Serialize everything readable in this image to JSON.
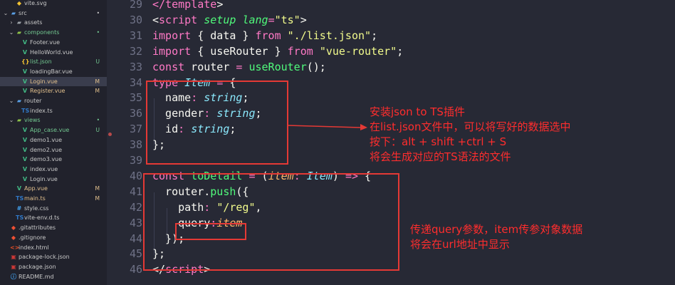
{
  "sidebar": {
    "items": [
      {
        "label": "vite.svg",
        "chev": "",
        "icon": "◆",
        "icon_color": "#f1c232",
        "label_color": "#c8c8c8",
        "badge": "",
        "indent": 22,
        "selected": false
      },
      {
        "label": "src",
        "chev": "⌄",
        "icon": "▰",
        "icon_color": "#5aa0e6",
        "label_color": "#c8c8c8",
        "badge": "•",
        "indent": 14,
        "selected": false
      },
      {
        "label": "assets",
        "chev": "›",
        "icon": "▰",
        "icon_color": "#9aa0a6",
        "label_color": "#c8c8c8",
        "badge": "",
        "indent": 22,
        "selected": false
      },
      {
        "label": "components",
        "chev": "⌄",
        "icon": "▰",
        "icon_color": "#8dc149",
        "label_color": "#73c991",
        "badge": "•",
        "indent": 22,
        "selected": false
      },
      {
        "label": "Footer.vue",
        "chev": "",
        "icon": "V",
        "icon_color": "#41b883",
        "label_color": "#c8c8c8",
        "badge": "",
        "indent": 30,
        "selected": false
      },
      {
        "label": "HelloWorld.vue",
        "chev": "",
        "icon": "V",
        "icon_color": "#41b883",
        "label_color": "#c8c8c8",
        "badge": "",
        "indent": 30,
        "selected": false
      },
      {
        "label": "list.json",
        "chev": "",
        "icon": "{}",
        "icon_color": "#f1c232",
        "label_color": "#73c991",
        "badge": "U",
        "indent": 30,
        "selected": false
      },
      {
        "label": "loadingBar.vue",
        "chev": "",
        "icon": "V",
        "icon_color": "#41b883",
        "label_color": "#c8c8c8",
        "badge": "",
        "indent": 30,
        "selected": false
      },
      {
        "label": "Login.vue",
        "chev": "",
        "icon": "V",
        "icon_color": "#41b883",
        "label_color": "#e2c08d",
        "badge": "M",
        "indent": 30,
        "selected": true
      },
      {
        "label": "Register.vue",
        "chev": "",
        "icon": "V",
        "icon_color": "#41b883",
        "label_color": "#e2c08d",
        "badge": "M",
        "indent": 30,
        "selected": false
      },
      {
        "label": "router",
        "chev": "⌄",
        "icon": "▰",
        "icon_color": "#5aa0e6",
        "label_color": "#c8c8c8",
        "badge": "",
        "indent": 22,
        "selected": false
      },
      {
        "label": "index.ts",
        "chev": "",
        "icon": "TS",
        "icon_color": "#3178c6",
        "label_color": "#c8c8c8",
        "badge": "",
        "indent": 30,
        "selected": false
      },
      {
        "label": "views",
        "chev": "⌄",
        "icon": "▰",
        "icon_color": "#8dc149",
        "label_color": "#73c991",
        "badge": "•",
        "indent": 22,
        "selected": false
      },
      {
        "label": "App_case.vue",
        "chev": "",
        "icon": "V",
        "icon_color": "#41b883",
        "label_color": "#73c991",
        "badge": "U",
        "indent": 30,
        "selected": false
      },
      {
        "label": "demo1.vue",
        "chev": "",
        "icon": "V",
        "icon_color": "#41b883",
        "label_color": "#c8c8c8",
        "badge": "",
        "indent": 30,
        "selected": false
      },
      {
        "label": "demo2.vue",
        "chev": "",
        "icon": "V",
        "icon_color": "#41b883",
        "label_color": "#c8c8c8",
        "badge": "",
        "indent": 30,
        "selected": false
      },
      {
        "label": "demo3.vue",
        "chev": "",
        "icon": "V",
        "icon_color": "#41b883",
        "label_color": "#c8c8c8",
        "badge": "",
        "indent": 30,
        "selected": false
      },
      {
        "label": "index.vue",
        "chev": "",
        "icon": "V",
        "icon_color": "#41b883",
        "label_color": "#c8c8c8",
        "badge": "",
        "indent": 30,
        "selected": false
      },
      {
        "label": "Login.vue",
        "chev": "",
        "icon": "V",
        "icon_color": "#41b883",
        "label_color": "#c8c8c8",
        "badge": "",
        "indent": 30,
        "selected": false
      },
      {
        "label": "App.vue",
        "chev": "",
        "icon": "V",
        "icon_color": "#41b883",
        "label_color": "#e2c08d",
        "badge": "M",
        "indent": 22,
        "selected": false
      },
      {
        "label": "main.ts",
        "chev": "",
        "icon": "TS",
        "icon_color": "#3178c6",
        "label_color": "#e2c08d",
        "badge": "M",
        "indent": 22,
        "selected": false
      },
      {
        "label": "style.css",
        "chev": "",
        "icon": "#",
        "icon_color": "#42a5f5",
        "label_color": "#c8c8c8",
        "badge": "",
        "indent": 22,
        "selected": false
      },
      {
        "label": "vite-env.d.ts",
        "chev": "",
        "icon": "TS",
        "icon_color": "#3178c6",
        "label_color": "#c8c8c8",
        "badge": "",
        "indent": 22,
        "selected": false
      },
      {
        "label": ".gitattributes",
        "chev": "",
        "icon": "◆",
        "icon_color": "#f05033",
        "label_color": "#c8c8c8",
        "badge": "",
        "indent": 14,
        "selected": false
      },
      {
        "label": ".gitignore",
        "chev": "",
        "icon": "◆",
        "icon_color": "#f05033",
        "label_color": "#c8c8c8",
        "badge": "",
        "indent": 14,
        "selected": false
      },
      {
        "label": "index.html",
        "chev": "",
        "icon": "<>",
        "icon_color": "#e44d26",
        "label_color": "#c8c8c8",
        "badge": "",
        "indent": 14,
        "selected": false
      },
      {
        "label": "package-lock.json",
        "chev": "",
        "icon": "▣",
        "icon_color": "#cb3837",
        "label_color": "#c8c8c8",
        "badge": "",
        "indent": 14,
        "selected": false
      },
      {
        "label": "package.json",
        "chev": "",
        "icon": "▣",
        "icon_color": "#cb3837",
        "label_color": "#c8c8c8",
        "badge": "",
        "indent": 14,
        "selected": false
      },
      {
        "label": "README.md",
        "chev": "",
        "icon": "ⓘ",
        "icon_color": "#42a5f5",
        "label_color": "#c8c8c8",
        "badge": "",
        "indent": 14,
        "selected": false
      }
    ]
  },
  "editor": {
    "lines": [
      {
        "n": "29",
        "tokens": [
          {
            "t": "</",
            "c": "tag"
          },
          {
            "t": "template",
            "c": "tag"
          },
          {
            "t": ">",
            "c": ""
          }
        ]
      },
      {
        "n": "30",
        "tokens": [
          {
            "t": "<",
            "c": ""
          },
          {
            "t": "script",
            "c": "tag"
          },
          {
            "t": " ",
            "c": ""
          },
          {
            "t": "setup",
            "c": "attr"
          },
          {
            "t": " ",
            "c": ""
          },
          {
            "t": "lang",
            "c": "attr"
          },
          {
            "t": "=",
            "c": "kw"
          },
          {
            "t": "\"ts\"",
            "c": "str"
          },
          {
            "t": ">",
            "c": ""
          }
        ]
      },
      {
        "n": "31",
        "tokens": [
          {
            "t": "import",
            "c": "kw"
          },
          {
            "t": " { data } ",
            "c": ""
          },
          {
            "t": "from",
            "c": "kw"
          },
          {
            "t": " ",
            "c": ""
          },
          {
            "t": "\"./list.json\"",
            "c": "str"
          },
          {
            "t": ";",
            "c": ""
          }
        ]
      },
      {
        "n": "32",
        "tokens": [
          {
            "t": "import",
            "c": "kw"
          },
          {
            "t": " { useRouter } ",
            "c": ""
          },
          {
            "t": "from",
            "c": "kw"
          },
          {
            "t": " ",
            "c": ""
          },
          {
            "t": "\"vue-router\"",
            "c": "str"
          },
          {
            "t": ";",
            "c": ""
          }
        ]
      },
      {
        "n": "33",
        "tokens": [
          {
            "t": "const",
            "c": "kw"
          },
          {
            "t": " router ",
            "c": ""
          },
          {
            "t": "=",
            "c": "kw"
          },
          {
            "t": " ",
            "c": ""
          },
          {
            "t": "useRouter",
            "c": "fn"
          },
          {
            "t": "();",
            "c": ""
          }
        ]
      },
      {
        "n": "34",
        "tokens": [
          {
            "t": "type",
            "c": "kw"
          },
          {
            "t": " ",
            "c": ""
          },
          {
            "t": "Item",
            "c": "typ"
          },
          {
            "t": " ",
            "c": ""
          },
          {
            "t": "=",
            "c": "kw"
          },
          {
            "t": " {",
            "c": ""
          }
        ]
      },
      {
        "n": "35",
        "tokens": [
          {
            "t": "  name",
            "c": ""
          },
          {
            "t": ":",
            "c": "kw"
          },
          {
            "t": " ",
            "c": ""
          },
          {
            "t": "string",
            "c": "typ"
          },
          {
            "t": ";",
            "c": ""
          }
        ]
      },
      {
        "n": "36",
        "tokens": [
          {
            "t": "  gender",
            "c": ""
          },
          {
            "t": ":",
            "c": "kw"
          },
          {
            "t": " ",
            "c": ""
          },
          {
            "t": "string",
            "c": "typ"
          },
          {
            "t": ";",
            "c": ""
          }
        ]
      },
      {
        "n": "37",
        "tokens": [
          {
            "t": "  id",
            "c": ""
          },
          {
            "t": ":",
            "c": "kw"
          },
          {
            "t": " ",
            "c": ""
          },
          {
            "t": "string",
            "c": "typ"
          },
          {
            "t": ";",
            "c": ""
          }
        ]
      },
      {
        "n": "38",
        "tokens": [
          {
            "t": "};",
            "c": ""
          }
        ]
      },
      {
        "n": "39",
        "tokens": []
      },
      {
        "n": "40",
        "tokens": [
          {
            "t": "const",
            "c": "kw"
          },
          {
            "t": " ",
            "c": ""
          },
          {
            "t": "toDetail",
            "c": "fn"
          },
          {
            "t": " ",
            "c": ""
          },
          {
            "t": "=",
            "c": "kw"
          },
          {
            "t": " (",
            "c": ""
          },
          {
            "t": "item",
            "c": "param"
          },
          {
            "t": ":",
            "c": "kw"
          },
          {
            "t": " ",
            "c": ""
          },
          {
            "t": "Item",
            "c": "typ"
          },
          {
            "t": ") ",
            "c": ""
          },
          {
            "t": "=>",
            "c": "kw"
          },
          {
            "t": " {",
            "c": ""
          }
        ]
      },
      {
        "n": "41",
        "tokens": [
          {
            "t": "  router.",
            "c": ""
          },
          {
            "t": "push",
            "c": "fn"
          },
          {
            "t": "({",
            "c": ""
          }
        ]
      },
      {
        "n": "42",
        "tokens": [
          {
            "t": "    path",
            "c": ""
          },
          {
            "t": ":",
            "c": "kw"
          },
          {
            "t": " ",
            "c": ""
          },
          {
            "t": "\"/reg\"",
            "c": "str"
          },
          {
            "t": ",",
            "c": ""
          }
        ]
      },
      {
        "n": "43",
        "tokens": [
          {
            "t": "    query",
            "c": ""
          },
          {
            "t": ":",
            "c": "kw"
          },
          {
            "t": "item",
            "c": "param"
          }
        ]
      },
      {
        "n": "44",
        "tokens": [
          {
            "t": "  });",
            "c": ""
          }
        ]
      },
      {
        "n": "45",
        "tokens": [
          {
            "t": "};",
            "c": ""
          }
        ]
      },
      {
        "n": "46",
        "tokens": [
          {
            "t": "</",
            "c": ""
          },
          {
            "t": "script",
            "c": "tag"
          },
          {
            "t": ">",
            "c": ""
          }
        ]
      }
    ]
  },
  "annotations": {
    "type_note": [
      "安装json to TS插件",
      "在list.json文件中，可以将写好的数据选中",
      "按下：alt + shift +ctrl + S",
      "将会生成对应的TS语法的文件"
    ],
    "query_note": [
      "传递query参数，item传参对象数据",
      "将会在url地址中显示"
    ]
  },
  "colors": {
    "annotation": "#ff2d2d",
    "keyword": "#ff79c6",
    "string": "#f1fa8c",
    "type": "#8be9fd",
    "function": "#50fa7b",
    "param": "#ffb86c"
  }
}
